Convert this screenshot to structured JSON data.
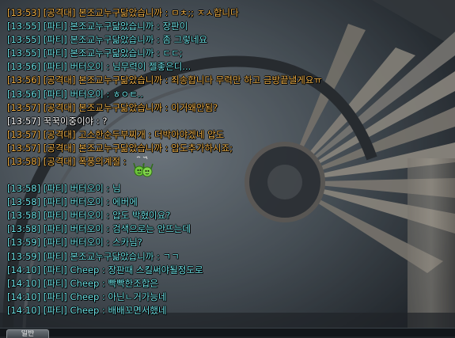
{
  "colors": {
    "party": "#6fe3e8",
    "guild": "#f0b24a",
    "normal": "#ffffff"
  },
  "chat": {
    "lines": [
      {
        "kind": "guild",
        "text": "[13:53] [공격대] 본조교누구닮았습니까 : ㅁㅊ;; ㅈㅅ합니다"
      },
      {
        "kind": "party",
        "text": "[13:55] [파티] 본조교누구닮았습니까 : 장판이"
      },
      {
        "kind": "party",
        "text": "[13:55] [파티] 본조교누구닮았습니까 : 좀 그렇네요"
      },
      {
        "kind": "party",
        "text": "[13:55] [파티] 본조교누구닮았습니까 : ㄷㄷ;"
      },
      {
        "kind": "party",
        "text": "[13:56] [파티] 버터오이 : 님무력이 젤좋은디..."
      },
      {
        "kind": "guild",
        "text": "[13:56] [공격대] 본조교누구닮았습니까 : 죄송합니다 무력만 하고 금방끝낼게요ㅠ"
      },
      {
        "kind": "party",
        "text": "[13:56] [파티] 버터오이 : ㅎㅇㅌ.."
      },
      {
        "kind": "guild",
        "text": "[13:57] [공격대] 본조교누구닮았습니까 : 이거왜안됨?"
      },
      {
        "kind": "normal",
        "text": "[13:57] 꾹꾹이중이야 : ?"
      },
      {
        "kind": "guild",
        "text": "[13:57] [공격대] 고소한순두부찌개 : 더박아야겠네 압도"
      },
      {
        "kind": "guild",
        "text": "[13:57] [공격대] 본조교누구닮았습니까 : 압도추가하시죠;"
      },
      {
        "kind": "guild",
        "text": "[13:58] [공격대] 폭풍의계절 :",
        "emoticon": "cheer-emoticon"
      },
      {
        "kind": "party",
        "text": "[13:58] [파티] 버터오이 : 님"
      },
      {
        "kind": "party",
        "text": "[13:58] [파티] 버터오이 : 에버에"
      },
      {
        "kind": "party",
        "text": "[13:58] [파티] 버터오이 : 압도 박혔이요?"
      },
      {
        "kind": "party",
        "text": "[13:58] [파티] 버터오이 : 검색으로는 안뜨는데"
      },
      {
        "kind": "party",
        "text": "[13:59] [파티] 버터오이 : 스카님?"
      },
      {
        "kind": "party",
        "text": "[13:59] [파티] 본조교누구닮았습니까 : ㄱㄱ"
      },
      {
        "kind": "party",
        "text": "[14:10] [파티] Cheep : 장판때 스킬써야될정도로"
      },
      {
        "kind": "party",
        "text": "[14:10] [파티] Cheep : 빡빡한조합은"
      },
      {
        "kind": "party",
        "text": "[14:10] [파티] Cheep : 아닌ㄴ거가능네"
      },
      {
        "kind": "party",
        "text": "[14:10] [파티] Cheep : 배배꼬면서했네"
      }
    ]
  },
  "tabs": {
    "general_label": "일반"
  }
}
